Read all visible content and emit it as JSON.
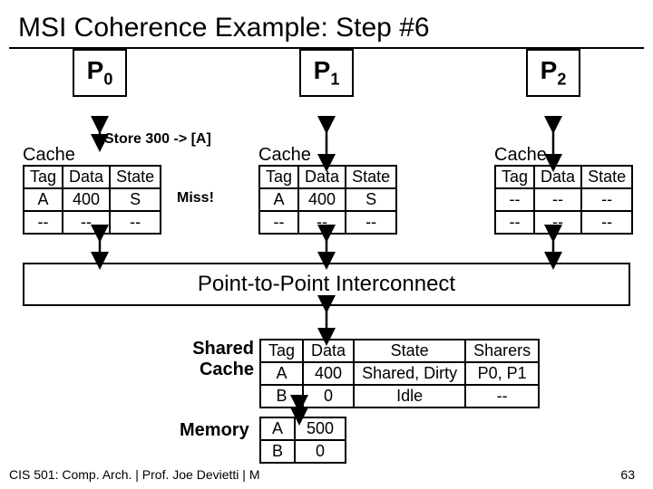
{
  "title": "MSI Coherence Example: Step #6",
  "procs": {
    "p0": "P",
    "p0sub": "0",
    "p1": "P",
    "p1sub": "1",
    "p2": "P",
    "p2sub": "2"
  },
  "store_label": "Store 300 -> [A]",
  "miss_label": "Miss!",
  "cache_label": "Cache",
  "cache_headers": {
    "tag": "Tag",
    "data": "Data",
    "state": "State"
  },
  "cache0": {
    "r0": {
      "tag": "A",
      "data": "400",
      "state": "S"
    },
    "r1": {
      "tag": "--",
      "data": "--",
      "state": "--"
    }
  },
  "cache1": {
    "r0": {
      "tag": "A",
      "data": "400",
      "state": "S"
    },
    "r1": {
      "tag": "--",
      "data": "--",
      "state": "--"
    }
  },
  "cache2": {
    "r0": {
      "tag": "--",
      "data": "--",
      "state": "--"
    },
    "r1": {
      "tag": "--",
      "data": "--",
      "state": "--"
    }
  },
  "interconnect": "Point-to-Point Interconnect",
  "shared_label_1": "Shared",
  "shared_label_2": "Cache",
  "shared_headers": {
    "tag": "Tag",
    "data": "Data",
    "state": "State",
    "sharers": "Sharers"
  },
  "shared": {
    "r0": {
      "tag": "A",
      "data": "400",
      "state": "Shared, Dirty",
      "sharers": "P0, P1"
    },
    "r1": {
      "tag": "B",
      "data": "0",
      "state": "Idle",
      "sharers": "--"
    }
  },
  "memory_label": "Memory",
  "memory": {
    "r0": {
      "addr": "A",
      "val": "500"
    },
    "r1": {
      "addr": "B",
      "val": "0"
    }
  },
  "footer": "CIS 501: Comp. Arch.  |  Prof. Joe Devietti  |  M",
  "pagenum": "63"
}
